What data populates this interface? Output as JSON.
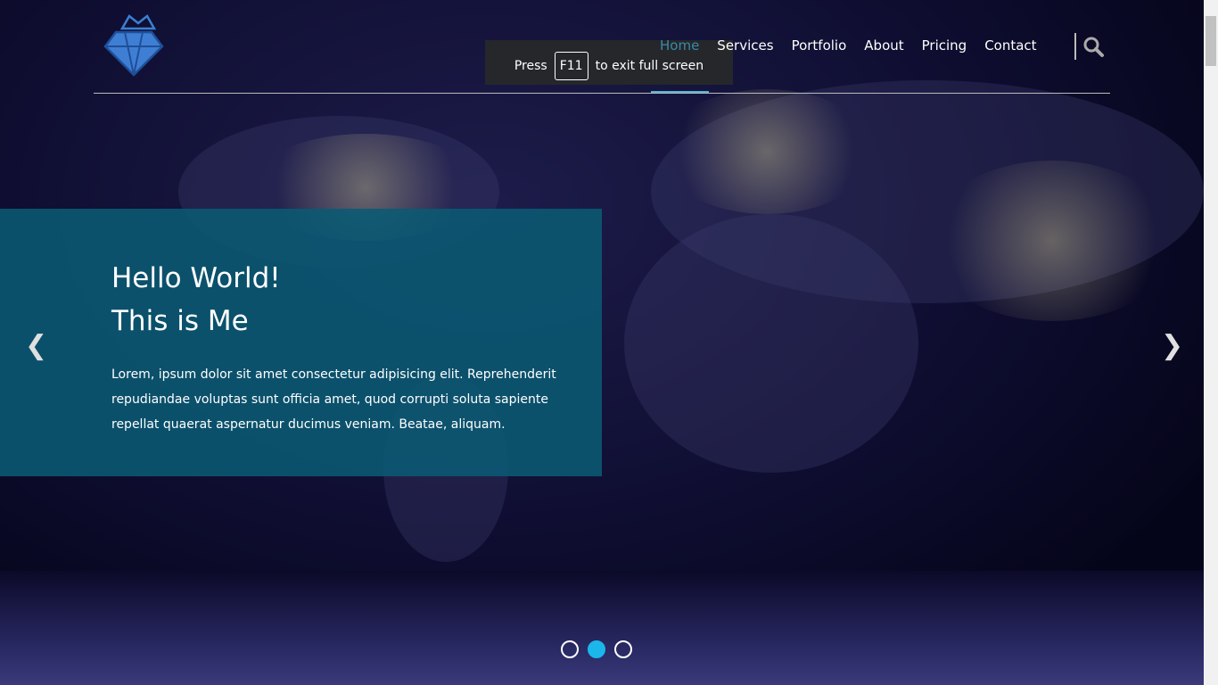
{
  "nav": {
    "items": [
      "Home",
      "Services",
      "Portfolio",
      "About",
      "Pricing",
      "Contact"
    ],
    "active": "Home"
  },
  "toast": {
    "before": "Press",
    "key": "F11",
    "after": "to exit full screen"
  },
  "hero": {
    "title_line1": "Hello World!",
    "title_line2": "This is Me",
    "body": "Lorem, ipsum dolor sit amet consectetur adipisicing elit. Reprehenderit repudiandae voluptas sunt officia amet, quod corrupti soluta sapiente repellat quaerat aspernatur ducimus veniam. Beatae, aliquam."
  },
  "carousel": {
    "prev_icon": "chevron-left-icon",
    "next_icon": "chevron-right-icon",
    "slides": 3,
    "active_slide": 2
  },
  "colors": {
    "accent": "#1bb7ea",
    "panel": "#0a5a73"
  }
}
